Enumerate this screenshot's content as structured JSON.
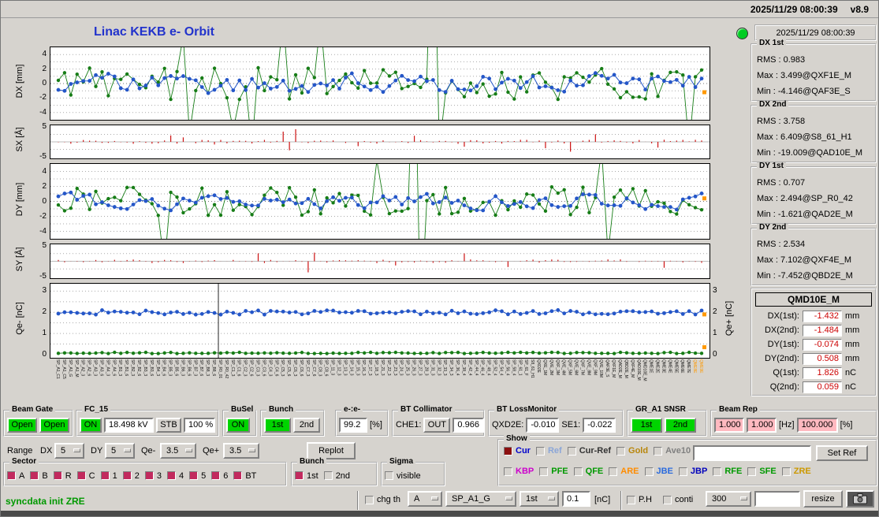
{
  "titlebar": {
    "timestamp": "2025/11/29 08:00:39",
    "version": "v8.9"
  },
  "title": "Linac KEKB e- Orbit",
  "plots": {
    "dx": {
      "ylabel": "DX [mm]",
      "ticks": [
        4,
        2,
        0,
        -2,
        -4
      ]
    },
    "sx": {
      "ylabel": "SX [Å]",
      "ticks": [
        5,
        -5
      ]
    },
    "dy": {
      "ylabel": "DY [mm]",
      "ticks": [
        4,
        2,
        0,
        -2,
        -4
      ]
    },
    "sy": {
      "ylabel": "SY [Å]",
      "ticks": [
        5,
        -5
      ]
    },
    "qe": {
      "ylabel_left": "Qe- [nC]",
      "ylabel_right": "Qe+ [nC]",
      "ticks": [
        3,
        2,
        1,
        0
      ]
    }
  },
  "plot_style": {
    "seed": 20251129,
    "green": "#177d17",
    "blue": "#2456c8",
    "red": "#cc1111",
    "orange": "#ff9900"
  },
  "bpm_labels": [
    "SP_A1_C1",
    "SP_A1_C5",
    "SP_A1_G",
    "SP_A1_M",
    "SP_A2_3",
    "SP_A2_6",
    "SP_A3_3",
    "SP_A3_6",
    "SP_A4_3",
    "SP_A4_6",
    "SP_B1_3",
    "SP_B1_6",
    "SP_B2_3",
    "SP_B2_6",
    "SP_B3_3",
    "SP_B3_6",
    "SP_B4_3",
    "SP_B4_6",
    "SP_B5_3",
    "SP_B5_6",
    "SP_B6_3",
    "SP_B6_6",
    "SP_B7_3",
    "SP_B7_6",
    "SP_B8_3",
    "SP_B8_6",
    "SP_R0_01",
    "SP_R0_42",
    "SP_C1_3",
    "SP_C1_6",
    "SP_C2_3",
    "SP_C2_6",
    "SP_C3_3",
    "SP_C3_6",
    "SP_C4_3",
    "SP_C4_6",
    "SP_C5_3",
    "SP_C5_6",
    "SP_C6_3",
    "SP_C6_6",
    "SP_C7_3",
    "SP_C7_6",
    "SP_C8_3",
    "SP_C8_6",
    "SP_11_3",
    "SP_12_3",
    "SP_13_3",
    "SP_14_3",
    "SP_15_3",
    "SP_16_3",
    "SP_17_3",
    "SP_18_3",
    "SP_21_3",
    "SP_22_3",
    "SP_23_3",
    "SP_24_3",
    "SP_25_3",
    "SP_26_3",
    "SP_27_3",
    "SP_28_3",
    "SP_31_3",
    "SP_32_3",
    "SP_33_3",
    "SP_34_3",
    "SP_36_4",
    "SP_38_4",
    "SP_42_4",
    "SP_44_4",
    "SP_46_4",
    "SP_48_4",
    "SP_52_4",
    "SP_54_4",
    "SP_56_4",
    "SP_58_4",
    "SP_61_1",
    "SP_61_F",
    "S8_61_H1",
    "QXD2E",
    "QXE_1M",
    "QVE_2M",
    "QXF_3M",
    "QVE_4M",
    "QXF_5M",
    "QVE_6M",
    "QXF_7M",
    "QVE_8M",
    "QXF_9M",
    "QVE_10M",
    "QAF3E_S",
    "QXF1E_M",
    "QAD2E_M",
    "QBD2E_M",
    "QXF4E_M",
    "QAD10E_M",
    "QMD10E_M",
    "QME1E",
    "QME2E",
    "QME3E",
    "QME4E",
    "QME5E",
    "QME6E",
    "QME7E",
    "QME8E",
    "QME9E"
  ],
  "stats_panel": {
    "timestamp": "2025/11/29 08:00:39",
    "groups": [
      {
        "title": "DX 1st",
        "rms": "RMS : 0.983",
        "max": "Max : 3.499@QXF1E_M",
        "min": "Min : -4.146@QAF3E_S"
      },
      {
        "title": "DX 2nd",
        "rms": "RMS : 3.758",
        "max": "Max : 6.409@S8_61_H1",
        "min": "Min : -19.009@QAD10E_M"
      },
      {
        "title": "DY 1st",
        "rms": "RMS : 0.707",
        "max": "Max : 2.494@SP_R0_42",
        "min": "Min : -1.621@QAD2E_M"
      },
      {
        "title": "DY 2nd",
        "rms": "RMS : 2.534",
        "max": "Max : 7.102@QXF4E_M",
        "min": "Min : -7.452@QBD2E_M"
      }
    ]
  },
  "qmd": {
    "title": "QMD10E_M",
    "rows": [
      {
        "label": "DX(1st):",
        "value": "-1.432",
        "unit": "mm"
      },
      {
        "label": "DX(2nd):",
        "value": "-1.484",
        "unit": "mm"
      },
      {
        "label": "DY(1st):",
        "value": "-0.074",
        "unit": "mm"
      },
      {
        "label": "DY(2nd):",
        "value": "0.508",
        "unit": "mm"
      },
      {
        "label": "Q(1st):",
        "value": "1.826",
        "unit": "nC"
      },
      {
        "label": "Q(2nd):",
        "value": "0.059",
        "unit": "nC"
      }
    ]
  },
  "controls": {
    "beam_gate": {
      "title": "Beam Gate",
      "open1": "Open",
      "open2": "Open"
    },
    "fc15": {
      "title": "FC_15",
      "on": "ON",
      "kv": "18.498 kV",
      "stb": "STB",
      "pct": "100 %"
    },
    "busel": {
      "title": "BuSel",
      "on": "ON"
    },
    "bunch": {
      "title": "Bunch",
      "first": "1st",
      "second": "2nd"
    },
    "ee_ratio": {
      "title": "e-:e-",
      "value": "99.2",
      "unit": "[%]"
    },
    "bt_collimator": {
      "title": "BT Collimator",
      "che1_label": "CHE1:",
      "che1_state": "OUT",
      "che1_value": "0.966"
    },
    "bt_lossmonitor": {
      "title": "BT LossMonitor",
      "qxd2e_label": "QXD2E:",
      "qxd2e_value": "-0.010",
      "se1_label": "SE1:",
      "se1_value": "-0.022"
    },
    "gr_a1_snsr": {
      "title": "GR_A1 SNSR",
      "first": "1st",
      "second": "2nd"
    },
    "beam_rep": {
      "title": "Beam Rep",
      "v1": "1.000",
      "v2": "1.000",
      "hz": "[Hz]",
      "v3": "100.000",
      "pct": "[%]"
    },
    "range": {
      "label": "Range",
      "dx_label": "DX",
      "dx_value": "5",
      "dy_label": "DY",
      "dy_value": "5",
      "qem_label": "Qe-",
      "qem_value": "3.5",
      "qep_label": "Qe+",
      "qep_value": "3.5",
      "replot": "Replot"
    },
    "sector": {
      "title": "Sector",
      "on_color": "#c22a5e",
      "items": [
        {
          "label": "A",
          "checked": true
        },
        {
          "label": "B",
          "checked": true
        },
        {
          "label": "R",
          "checked": true
        },
        {
          "label": "C",
          "checked": true
        },
        {
          "label": "1",
          "checked": true
        },
        {
          "label": "2",
          "checked": true
        },
        {
          "label": "3",
          "checked": true
        },
        {
          "label": "4",
          "checked": true
        },
        {
          "label": "5",
          "checked": true
        },
        {
          "label": "6",
          "checked": true
        },
        {
          "label": "BT",
          "checked": true
        }
      ]
    },
    "bunch_sel": {
      "title": "Bunch",
      "on_color": "#c22a5e",
      "items": [
        {
          "label": "1st",
          "checked": true
        },
        {
          "label": "2nd",
          "checked": false
        }
      ]
    },
    "sigma": {
      "title": "Sigma",
      "on_color": "#c22a5e",
      "items": [
        {
          "label": "visible",
          "checked": false
        }
      ]
    },
    "show": {
      "title": "Show",
      "on_color": "#8c1010",
      "row1": [
        {
          "label": "Cur",
          "color": "#0000cc",
          "checked": true
        },
        {
          "label": "Ref",
          "color": "#8ba6d8",
          "checked": false
        },
        {
          "label": "Cur-Ref",
          "color": "#333333",
          "checked": false
        },
        {
          "label": "Gold",
          "color": "#b8860b",
          "checked": false
        },
        {
          "label": "Ave10",
          "color": "#808080",
          "checked": false
        }
      ],
      "ref_entry": "",
      "set_ref": "Set Ref",
      "row2": [
        {
          "label": "KBP",
          "color": "#cc00cc",
          "checked": false
        },
        {
          "label": "PFE",
          "color": "#009900",
          "checked": false
        },
        {
          "label": "QFE",
          "color": "#009900",
          "checked": false
        },
        {
          "label": "ARE",
          "color": "#ff8c00",
          "checked": false
        },
        {
          "label": "JBE",
          "color": "#2b6bdd",
          "checked": false
        },
        {
          "label": "JBP",
          "color": "#0000bb",
          "checked": false
        },
        {
          "label": "RFE",
          "color": "#009900",
          "checked": false
        },
        {
          "label": "SFE",
          "color": "#009900",
          "checked": false
        },
        {
          "label": "ZRE",
          "color": "#cc9900",
          "checked": false
        }
      ]
    },
    "statusbar": {
      "message": "syncdata init ZRE",
      "chg_th": "chg th",
      "mode": "A",
      "sp": "SP_A1_G",
      "bunch": "1st",
      "threshold": "0.1",
      "threshold_unit": "[nC]",
      "ph": "P.H",
      "conti": "conti",
      "interval": "300",
      "entry": "",
      "resize": "resize"
    }
  }
}
